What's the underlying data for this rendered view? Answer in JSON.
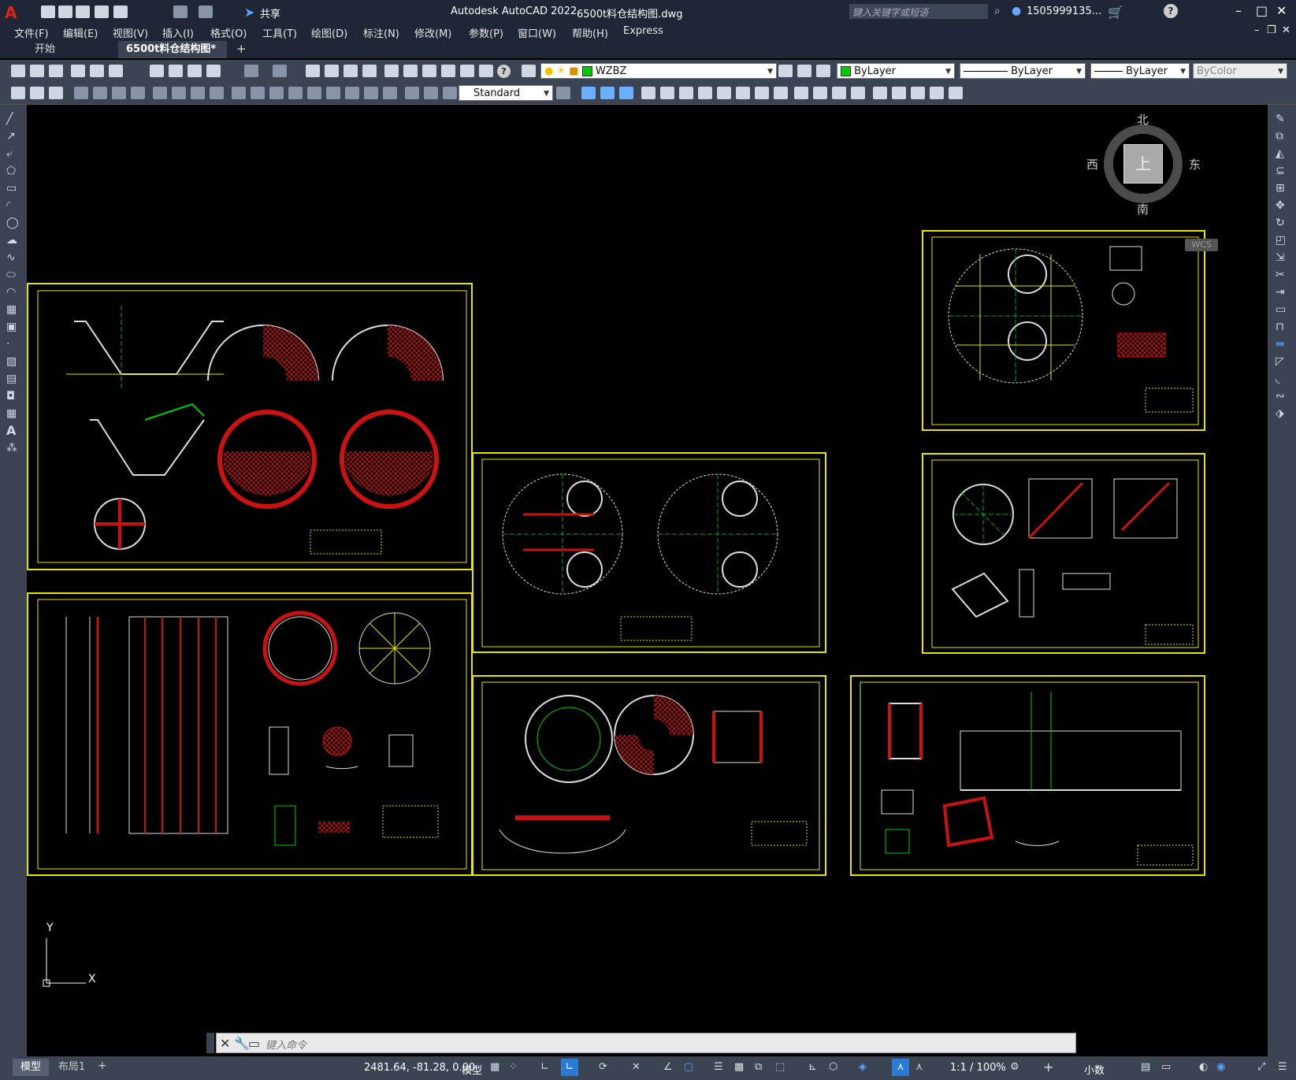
{
  "app": {
    "title": "Autodesk AutoCAD 2022",
    "file": "6500t料仓结构图.dwg",
    "share": "共享",
    "search_placeholder": "键入关键字或短语",
    "user": "1505999135..."
  },
  "menu": [
    "文件(F)",
    "编辑(E)",
    "视图(V)",
    "插入(I)",
    "格式(O)",
    "工具(T)",
    "绘图(D)",
    "标注(N)",
    "修改(M)",
    "参数(P)",
    "窗口(W)",
    "帮助(H)",
    "Express"
  ],
  "tabs": [
    {
      "label": "开始"
    },
    {
      "label": "6500t料仓结构图*"
    }
  ],
  "toolbar": {
    "layer": "WZBZ",
    "color": "ByLayer",
    "linetype": "ByLayer",
    "lineweight": "ByLayer",
    "plotstyle": "ByColor",
    "textstyle": "Standard"
  },
  "viewcube": {
    "north": "北",
    "south": "南",
    "east": "东",
    "west": "西",
    "face": "上",
    "wcs": "WCS"
  },
  "ucs": {
    "x": "X",
    "y": "Y"
  },
  "command": {
    "placeholder": "键入命令"
  },
  "layout_tabs": {
    "model": "模型",
    "layout1": "布局1"
  },
  "status": {
    "coords": "2481.64, -81.28, 0.00",
    "space": "模型",
    "scale": "1:1 / 100%",
    "units": "小数"
  },
  "colors": {
    "frame": "#e6e600",
    "accent_green": "#00cc00",
    "accent_red": "#cc1111"
  }
}
